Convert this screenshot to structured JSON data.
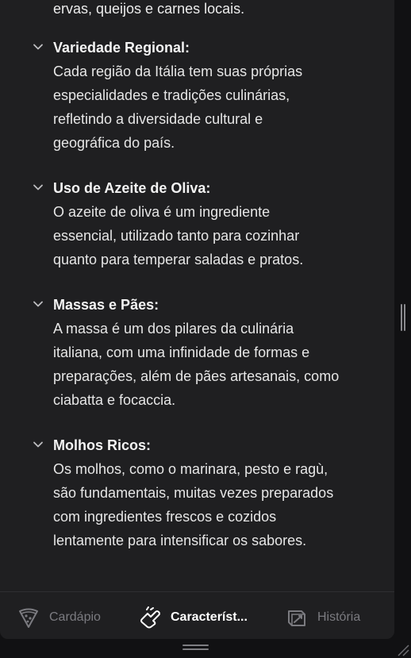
{
  "intro": {
    "trailing_line": "ervas, queijos e carnes locais."
  },
  "items": [
    {
      "title": "Variedade Regional:",
      "lines": [
        "Cada região da Itália tem suas próprias",
        "especialidades e tradições culinárias,",
        "refletindo a diversidade cultural e",
        "geográfica do país."
      ]
    },
    {
      "title": "Uso de Azeite de Oliva:",
      "lines": [
        "O azeite de oliva é um ingrediente",
        "essencial, utilizado tanto para cozinhar",
        "quanto para temperar saladas e pratos."
      ]
    },
    {
      "title": "Massas e Pães:",
      "lines": [
        "A massa é um dos pilares da culinária",
        "italiana, com uma infinidade de formas e",
        "preparações, além de pães artesanais, como",
        "ciabatta e focaccia."
      ]
    },
    {
      "title": "Molhos Ricos:",
      "lines": [
        "Os molhos, como o marinara, pesto e ragù,",
        "são fundamentais, muitas vezes preparados",
        "com ingredientes frescos e cozidos",
        "lentamente para intensificar os sabores."
      ]
    }
  ],
  "nav": {
    "tabs": [
      {
        "label": "Cardápio",
        "icon": "pizza-slice-icon",
        "active": false
      },
      {
        "label": "Característ...",
        "icon": "hand-pointing-icon",
        "active": true
      },
      {
        "label": "História",
        "icon": "book-history-icon",
        "active": false
      }
    ]
  },
  "colors": {
    "background": "#111113",
    "panel": "#1f1f21",
    "text": "#e6e6e6",
    "muted": "#7b7b80",
    "active": "#ffffff"
  }
}
